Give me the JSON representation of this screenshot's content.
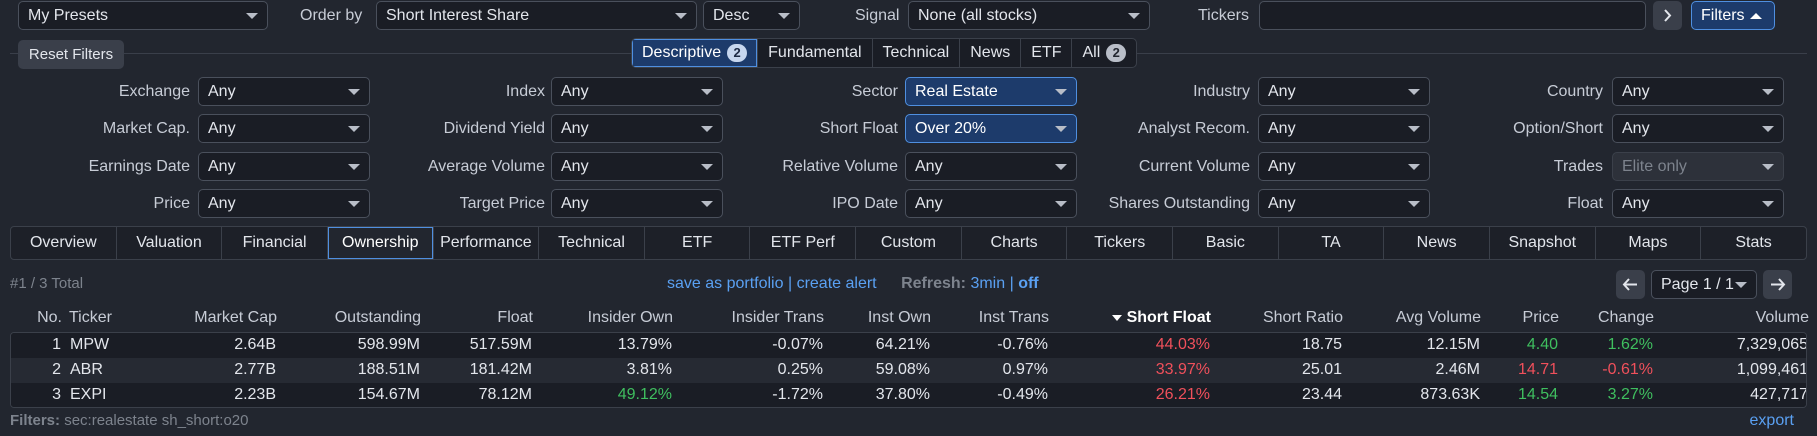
{
  "topbar": {
    "presets": "My Presets",
    "order_by_label": "Order by",
    "order_by_value": "Short Interest Share",
    "order_dir": "Desc",
    "signal_label": "Signal",
    "signal_value": "None (all stocks)",
    "tickers_label": "Tickers",
    "tickers_value": "",
    "go_icon": "chevron-right-icon",
    "filters_label": "Filters",
    "filters_icon": "caret-up-icon"
  },
  "reset_filters": "Reset Filters",
  "filter_tabs": [
    {
      "label": "Descriptive",
      "badge": "2",
      "active": true
    },
    {
      "label": "Fundamental",
      "badge": "",
      "active": false
    },
    {
      "label": "Technical",
      "badge": "",
      "active": false
    },
    {
      "label": "News",
      "badge": "",
      "active": false
    },
    {
      "label": "ETF",
      "badge": "",
      "active": false
    },
    {
      "label": "All",
      "badge": "2",
      "active": false
    }
  ],
  "filters": [
    {
      "label": "Exchange",
      "value": "Any"
    },
    {
      "label": "Index",
      "value": "Any"
    },
    {
      "label": "Sector",
      "value": "Real Estate",
      "active": true
    },
    {
      "label": "Industry",
      "value": "Any"
    },
    {
      "label": "Country",
      "value": "Any"
    },
    {
      "label": "Market Cap.",
      "value": "Any"
    },
    {
      "label": "Dividend Yield",
      "value": "Any"
    },
    {
      "label": "Short Float",
      "value": "Over 20%",
      "active": true
    },
    {
      "label": "Analyst Recom.",
      "value": "Any"
    },
    {
      "label": "Option/Short",
      "value": "Any"
    },
    {
      "label": "Earnings Date",
      "value": "Any"
    },
    {
      "label": "Average Volume",
      "value": "Any"
    },
    {
      "label": "Relative Volume",
      "value": "Any"
    },
    {
      "label": "Current Volume",
      "value": "Any"
    },
    {
      "label": "Trades",
      "value": "Elite only",
      "disabled": true
    },
    {
      "label": "Price",
      "value": "Any"
    },
    {
      "label": "Target Price",
      "value": "Any"
    },
    {
      "label": "IPO Date",
      "value": "Any"
    },
    {
      "label": "Shares Outstanding",
      "value": "Any"
    },
    {
      "label": "Float",
      "value": "Any"
    }
  ],
  "view_tabs": [
    "Overview",
    "Valuation",
    "Financial",
    "Ownership",
    "Performance",
    "Technical",
    "ETF",
    "ETF Perf",
    "Custom",
    "Charts",
    "Tickers",
    "Basic",
    "TA",
    "News",
    "Snapshot",
    "Maps",
    "Stats"
  ],
  "active_view": "Ownership",
  "status": {
    "total": "#1 / 3 Total",
    "save_portfolio": "save as portfolio",
    "sep": "|",
    "create_alert": "create alert",
    "refresh_label": "Refresh:",
    "refresh_interval": "3min",
    "refresh_off": "off",
    "page": "Page 1 / 1",
    "prev_icon": "arrow-left-icon",
    "next_icon": "arrow-right-icon"
  },
  "table": {
    "headers": [
      "No.",
      "Ticker",
      "Market Cap",
      "Outstanding",
      "Float",
      "Insider Own",
      "Insider Trans",
      "Inst Own",
      "Inst Trans",
      "Short Float",
      "Short Ratio",
      "Avg Volume",
      "Price",
      "Change",
      "Volume"
    ],
    "sort_icon": "sort-desc-icon",
    "rows": [
      [
        "1",
        "MPW",
        "2.64B",
        "598.99M",
        "517.59M",
        "13.79%",
        "-0.07%",
        "64.21%",
        "-0.76%",
        "44.03%",
        "18.75",
        "12.15M",
        "4.40",
        "1.62%",
        "7,329,065"
      ],
      [
        "2",
        "ABR",
        "2.77B",
        "188.51M",
        "181.42M",
        "3.81%",
        "0.25%",
        "59.08%",
        "0.97%",
        "33.97%",
        "25.01",
        "2.46M",
        "14.71",
        "-0.61%",
        "1,099,461"
      ],
      [
        "3",
        "EXPI",
        "2.23B",
        "154.67M",
        "78.12M",
        "49.12%",
        "-1.72%",
        "37.80%",
        "-0.49%",
        "26.21%",
        "23.44",
        "873.63K",
        "14.54",
        "3.27%",
        "427,717"
      ]
    ]
  },
  "footer": {
    "filters_label": "Filters:",
    "filters_value": "sec:realestate sh_short:o20",
    "export": "export"
  },
  "colors": {
    "accent": "#4f8fe0",
    "positive": "#3fbf5f",
    "negative": "#f0505b"
  }
}
